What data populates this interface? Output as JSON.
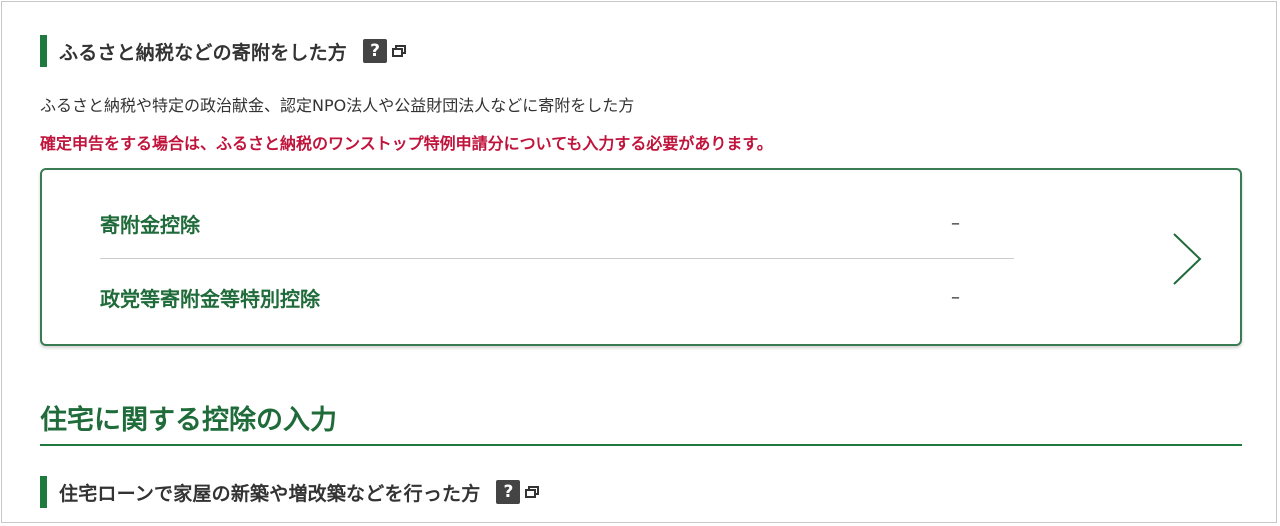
{
  "donation": {
    "heading": "ふるさと納税などの寄附をした方",
    "help_label": "?",
    "description": "ふるさと納税や特定の政治献金、認定NPO法人や公益財団法人などに寄附をした方",
    "warning": "確定申告をする場合は、ふるさと納税のワンストップ特例申請分についても入力する必要があります。",
    "rows": [
      {
        "label": "寄附金控除",
        "value": "–"
      },
      {
        "label": "政党等寄附金等特別控除",
        "value": "–"
      }
    ]
  },
  "housing": {
    "section_title": "住宅に関する控除の入力",
    "heading": "住宅ローンで家屋の新築や増改築などを行った方",
    "help_label": "?"
  },
  "colors": {
    "accent_green": "#1f7a3f",
    "warning_red": "#c0143c"
  },
  "icons": [
    "help-icon",
    "new-window-icon",
    "chevron-right-icon"
  ]
}
